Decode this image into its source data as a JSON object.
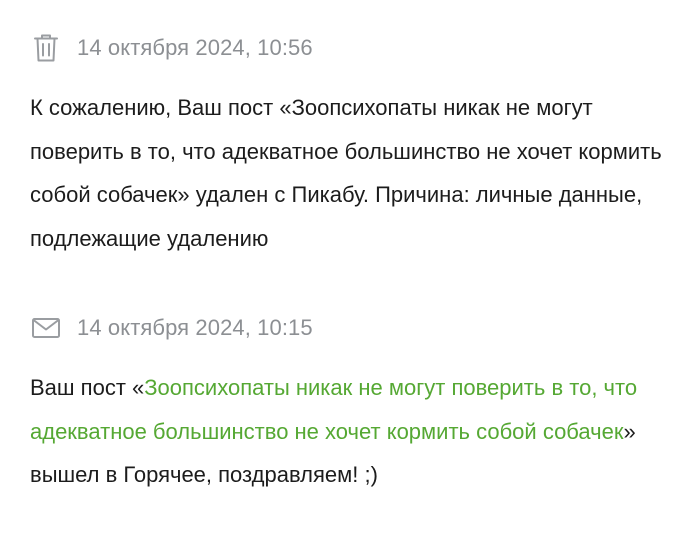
{
  "notifications": [
    {
      "icon": "trash-icon",
      "date": "14 октября 2024, 10:56",
      "text": "К сожалению, Ваш пост «Зоопсихопаты никак не могут поверить в то, что адекватное большинство не хочет кормить собой собачек» удален с Пикабу. Причина: личные данные, подлежащие удалению"
    },
    {
      "icon": "envelope-icon",
      "date": "14 октября 2024, 10:15",
      "text_before": "Ваш пост «",
      "link_text": "Зоопсихопаты никак не могут поверить в то, что адекватное большинство не хочет кормить собой собачек",
      "text_after": "» вышел в Горячее, поздравляем! ;)"
    }
  ],
  "colors": {
    "link": "#55a833",
    "date": "#8c8f93",
    "icon": "#9a9da1",
    "text": "#1c1c1c"
  }
}
